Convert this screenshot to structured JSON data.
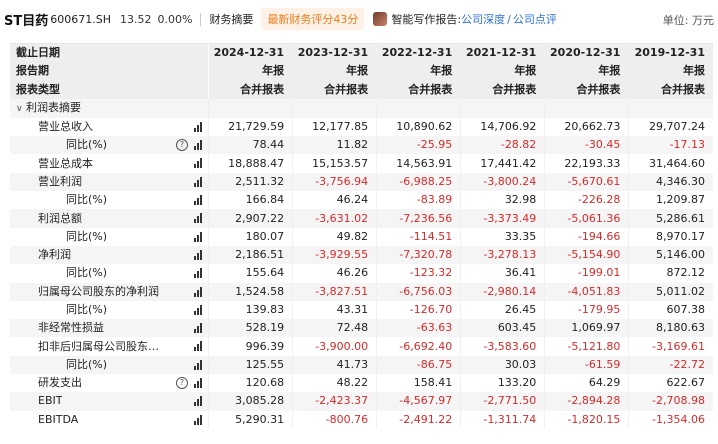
{
  "header": {
    "stock_name": "ST目药",
    "stock_code": "600671.SH",
    "price": "13.52",
    "change": "0.00%",
    "summary_label": "财务摘要",
    "score_button": "最新财务评分43分",
    "writer_label": "智能写作报告:",
    "link_depth": "公司深度",
    "link_separator": "/",
    "link_review": "公司点评",
    "unit": "单位: 万元"
  },
  "columns": {
    "row_labels": [
      "截止日期",
      "报告期",
      "报表类型"
    ],
    "periods": [
      {
        "date": "2024-12-31",
        "period": "年报",
        "type": "合并报表"
      },
      {
        "date": "2023-12-31",
        "period": "年报",
        "type": "合并报表"
      },
      {
        "date": "2022-12-31",
        "period": "年报",
        "type": "合并报表"
      },
      {
        "date": "2021-12-31",
        "period": "年报",
        "type": "合并报表"
      },
      {
        "date": "2020-12-31",
        "period": "年报",
        "type": "合并报表"
      },
      {
        "date": "2019-12-31",
        "period": "年报",
        "type": "合并报表"
      }
    ]
  },
  "section": {
    "label": "利润表摘要",
    "caret_icon": "chevron-down-icon"
  },
  "rows": [
    {
      "label": "营业总收入",
      "level": 1,
      "help": false,
      "values": [
        "21,729.59",
        "12,177.85",
        "10,890.62",
        "14,706.92",
        "20,662.73",
        "29,707.24"
      ]
    },
    {
      "label": "同比(%)",
      "level": 2,
      "help": true,
      "values": [
        "78.44",
        "11.82",
        "-25.95",
        "-28.82",
        "-30.45",
        "-17.13"
      ]
    },
    {
      "label": "营业总成本",
      "level": 1,
      "help": false,
      "values": [
        "18,888.47",
        "15,153.57",
        "14,563.91",
        "17,441.42",
        "22,193.33",
        "31,464.60"
      ]
    },
    {
      "label": "营业利润",
      "level": 1,
      "help": false,
      "values": [
        "2,511.32",
        "-3,756.94",
        "-6,988.25",
        "-3,800.24",
        "-5,670.61",
        "4,346.30"
      ]
    },
    {
      "label": "同比(%)",
      "level": 2,
      "help": false,
      "values": [
        "166.84",
        "46.24",
        "-83.89",
        "32.98",
        "-226.28",
        "1,209.87"
      ]
    },
    {
      "label": "利润总额",
      "level": 1,
      "help": false,
      "values": [
        "2,907.22",
        "-3,631.02",
        "-7,236.56",
        "-3,373.49",
        "-5,061.36",
        "5,286.61"
      ]
    },
    {
      "label": "同比(%)",
      "level": 2,
      "help": false,
      "values": [
        "180.07",
        "49.82",
        "-114.51",
        "33.35",
        "-194.66",
        "8,970.17"
      ]
    },
    {
      "label": "净利润",
      "level": 1,
      "help": false,
      "values": [
        "2,186.51",
        "-3,929.55",
        "-7,320.78",
        "-3,278.13",
        "-5,154.90",
        "5,146.00"
      ]
    },
    {
      "label": "同比(%)",
      "level": 2,
      "help": false,
      "values": [
        "155.64",
        "46.26",
        "-123.32",
        "36.41",
        "-199.01",
        "872.12"
      ]
    },
    {
      "label": "归属母公司股东的净利润",
      "level": 1,
      "help": false,
      "values": [
        "1,524.58",
        "-3,827.51",
        "-6,756.03",
        "-2,980.14",
        "-4,051.83",
        "5,011.02"
      ]
    },
    {
      "label": "同比(%)",
      "level": 2,
      "help": false,
      "values": [
        "139.83",
        "43.31",
        "-126.70",
        "26.45",
        "-179.95",
        "607.38"
      ]
    },
    {
      "label": "非经常性损益",
      "level": 1,
      "help": false,
      "values": [
        "528.19",
        "72.48",
        "-63.63",
        "603.45",
        "1,069.97",
        "8,180.63"
      ]
    },
    {
      "label": "扣非后归属母公司股东的…",
      "level": 1,
      "help": false,
      "values": [
        "996.39",
        "-3,900.00",
        "-6,692.40",
        "-3,583.60",
        "-5,121.80",
        "-3,169.61"
      ]
    },
    {
      "label": "同比(%)",
      "level": 2,
      "help": false,
      "values": [
        "125.55",
        "41.73",
        "-86.75",
        "30.03",
        "-61.59",
        "-22.72"
      ]
    },
    {
      "label": "研发支出",
      "level": 1,
      "help": true,
      "values": [
        "120.68",
        "48.22",
        "158.41",
        "133.20",
        "64.29",
        "622.67"
      ]
    },
    {
      "label": "EBIT",
      "level": 1,
      "help": false,
      "values": [
        "3,085.28",
        "-2,423.37",
        "-4,567.97",
        "-2,771.50",
        "-2,894.28",
        "-2,708.98"
      ]
    },
    {
      "label": "EBITDA",
      "level": 1,
      "help": false,
      "values": [
        "5,290.31",
        "-800.76",
        "-2,491.22",
        "-1,311.74",
        "-1,820.15",
        "-1,354.06"
      ]
    }
  ],
  "icons": {
    "chart": "bar-chart-icon",
    "help": "question-circle-icon"
  },
  "colors": {
    "negative": "#d52b2b",
    "accent_orange": "#f07a1a",
    "link_blue": "#2f6fd6"
  }
}
